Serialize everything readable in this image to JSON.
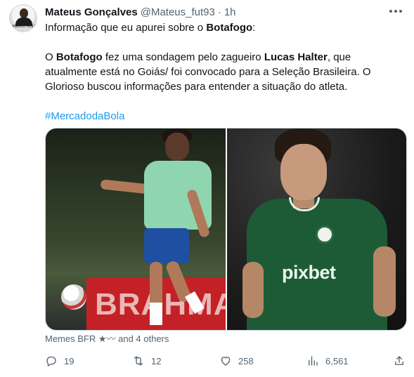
{
  "author": {
    "name": "Mateus Gonçalves",
    "handle": "@Mateus_fut93",
    "separator": "·",
    "time": "1h",
    "avatar_label": "Mateus fut93"
  },
  "tweet": {
    "line1_prefix": "Informação que eu apurei sobre o ",
    "line1_bold": "Botafogo",
    "line1_suffix": ":",
    "p2_a": "O ",
    "p2_b": "Botafogo",
    "p2_c": " fez uma sondagem pelo zagueiro ",
    "p2_d": "Lucas Halter",
    "p2_e": ", que atualmente está no Goiás/ foi convocado para a Seleção Brasileira. O Glorioso buscou informações para entender a situação do atleta.",
    "hashtag": "#MercadodaBola"
  },
  "media": {
    "left_banner_text": "BRAHMA",
    "right_sponsor_text": "pixbet"
  },
  "liked_by": "Memes BFR ★〰 and 4 others",
  "actions": {
    "replies": "19",
    "retweets": "12",
    "likes": "258",
    "views": "6,561"
  },
  "icons": [
    "more-icon",
    "reply-icon",
    "retweet-icon",
    "like-icon",
    "views-icon",
    "share-icon"
  ],
  "colors": {
    "accent": "#1d9bf0",
    "secondary_text": "#536471",
    "primary_text": "#0f1419"
  }
}
